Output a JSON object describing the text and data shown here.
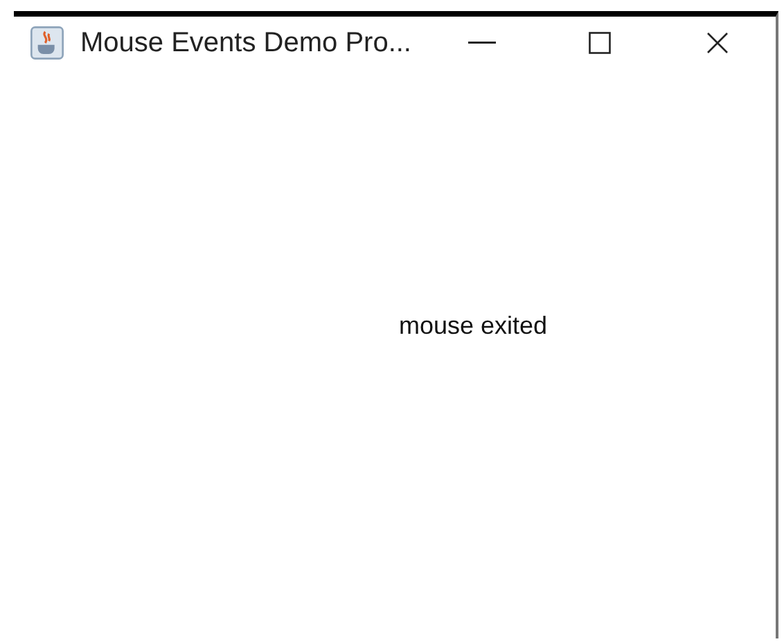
{
  "window": {
    "title": "Mouse Events Demo Pro..."
  },
  "content": {
    "label": "mouse exited"
  }
}
